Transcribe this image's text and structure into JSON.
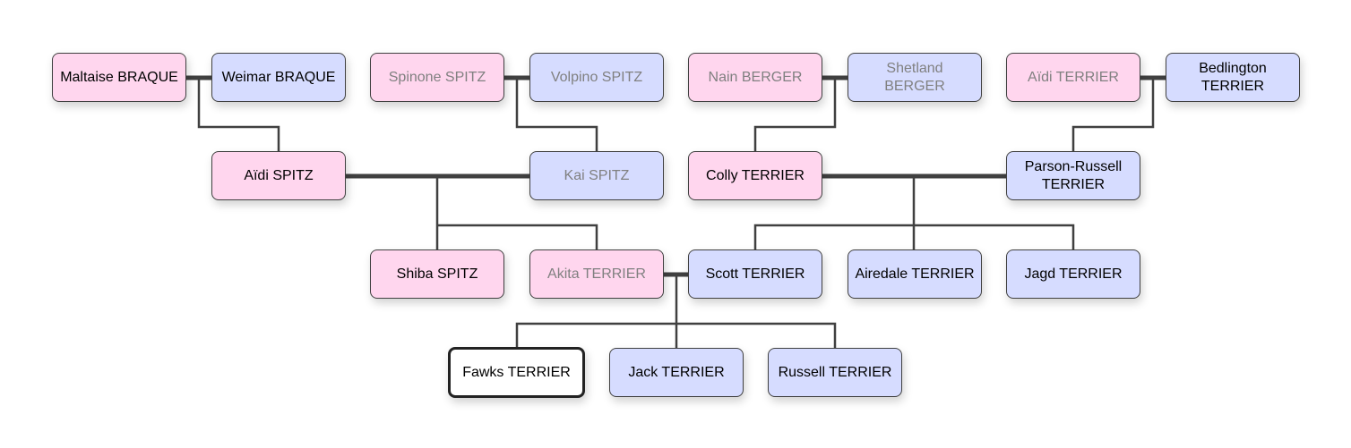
{
  "colors": {
    "female": "#ffd6ee",
    "male": "#d6dcff",
    "line": "#404040",
    "muted_text": "#808080"
  },
  "nodes": {
    "maltaise_braque": {
      "label": "Maltaise BRAQUE",
      "sex": "female"
    },
    "weimar_braque": {
      "label": "Weimar BRAQUE",
      "sex": "male"
    },
    "spinone_spitz": {
      "label": "Spinone SPITZ",
      "sex": "female",
      "muted": true
    },
    "volpino_spitz": {
      "label": "Volpino SPITZ",
      "sex": "male",
      "muted": true
    },
    "nain_berger": {
      "label": "Nain BERGER",
      "sex": "female",
      "muted": true
    },
    "shetland_berger": {
      "label": "Shetland BERGER",
      "sex": "male",
      "muted": true
    },
    "aidi_terrier": {
      "label": "Aïdi TERRIER",
      "sex": "female",
      "muted": true
    },
    "bedlington_terrier": {
      "label": "Bedlington TERRIER",
      "sex": "male"
    },
    "aidi_spitz": {
      "label": "Aïdi SPITZ",
      "sex": "female"
    },
    "kai_spitz": {
      "label": "Kai SPITZ",
      "sex": "male",
      "muted": true
    },
    "colly_terrier": {
      "label": "Colly TERRIER",
      "sex": "female"
    },
    "parson_russell_terrier": {
      "label": "Parson-Russell TERRIER",
      "sex": "male"
    },
    "shiba_spitz": {
      "label": "Shiba SPITZ",
      "sex": "female"
    },
    "akita_terrier": {
      "label": "Akita TERRIER",
      "sex": "female",
      "muted": true
    },
    "scott_terrier": {
      "label": "Scott TERRIER",
      "sex": "male"
    },
    "airedale_terrier": {
      "label": "Airedale TERRIER",
      "sex": "male"
    },
    "jagd_terrier": {
      "label": "Jagd TERRIER",
      "sex": "male"
    },
    "fawks_terrier": {
      "label": "Fawks TERRIER",
      "sex": "unknown",
      "selected": true
    },
    "jack_terrier": {
      "label": "Jack TERRIER",
      "sex": "male"
    },
    "russell_terrier": {
      "label": "Russell TERRIER",
      "sex": "male"
    }
  },
  "families": [
    {
      "parents": [
        "maltaise_braque",
        "weimar_braque"
      ],
      "children": [
        "aidi_spitz"
      ]
    },
    {
      "parents": [
        "spinone_spitz",
        "volpino_spitz"
      ],
      "children": [
        "kai_spitz"
      ]
    },
    {
      "parents": [
        "nain_berger",
        "shetland_berger"
      ],
      "children": [
        "colly_terrier"
      ]
    },
    {
      "parents": [
        "aidi_terrier",
        "bedlington_terrier"
      ],
      "children": [
        "parson_russell_terrier"
      ]
    },
    {
      "parents": [
        "aidi_spitz",
        "kai_spitz"
      ],
      "children": [
        "shiba_spitz",
        "akita_terrier"
      ]
    },
    {
      "parents": [
        "colly_terrier",
        "parson_russell_terrier"
      ],
      "children": [
        "scott_terrier",
        "airedale_terrier",
        "jagd_terrier"
      ]
    },
    {
      "parents": [
        "akita_terrier",
        "scott_terrier"
      ],
      "children": [
        "fawks_terrier",
        "jack_terrier",
        "russell_terrier"
      ]
    }
  ]
}
